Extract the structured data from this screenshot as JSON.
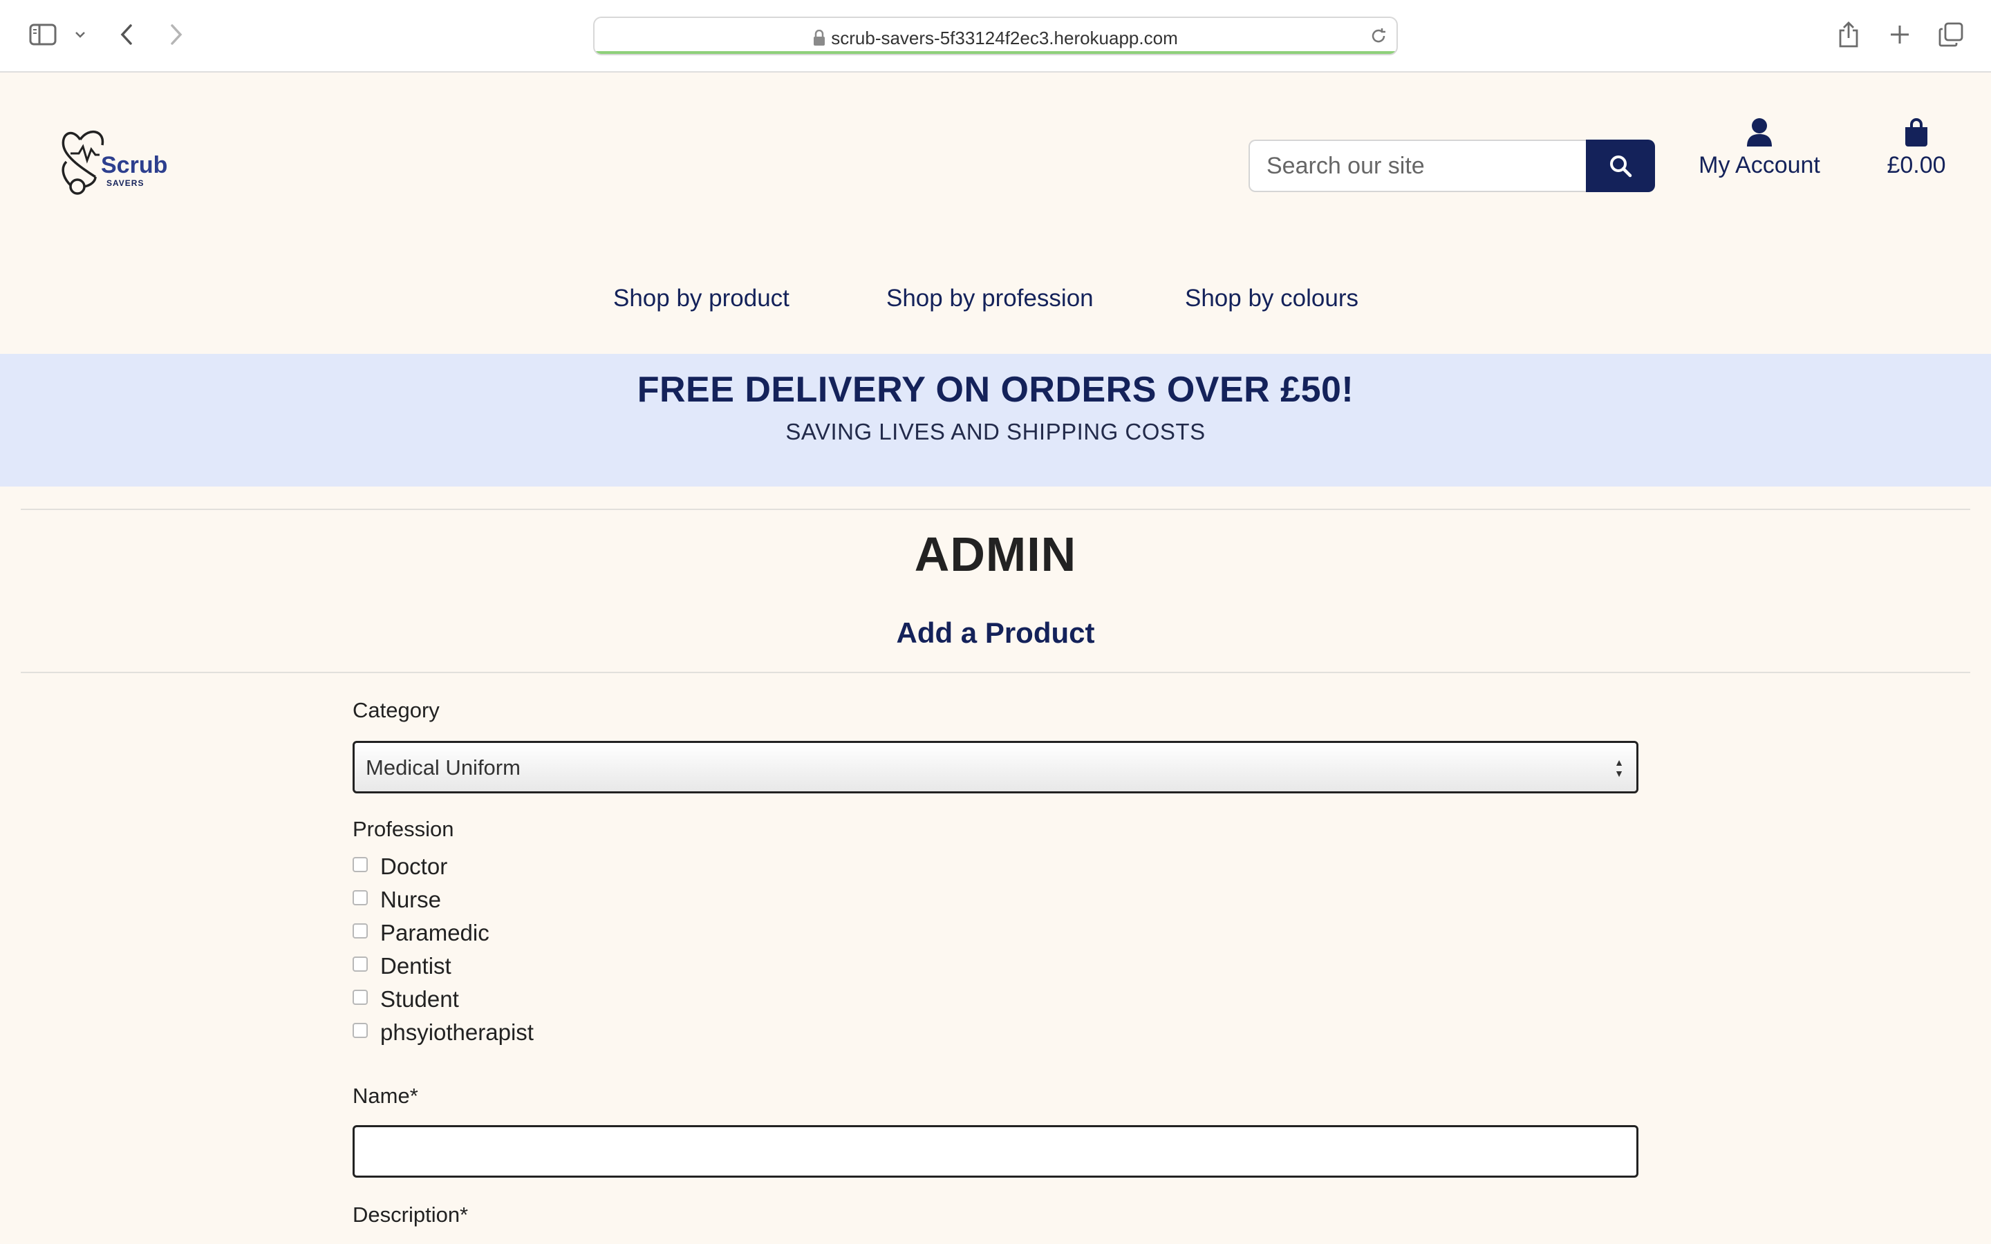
{
  "browser": {
    "url": "scrub-savers-5f33124f2ec3.herokuapp.com"
  },
  "brand": {
    "logo_main": "Scrub",
    "logo_sub": "SAVERS",
    "primary_color": "#14225a",
    "banner_color": "#e1e8fa",
    "page_bg": "#fdf8f1"
  },
  "header": {
    "search_placeholder": "Search our site",
    "account_label": "My Account",
    "cart_total": "£0.00"
  },
  "nav": {
    "items": [
      "Shop by product",
      "Shop by profession",
      "Shop by colours"
    ]
  },
  "banner": {
    "headline": "FREE DELIVERY ON ORDERS OVER £50!",
    "subline": "SAVING LIVES AND SHIPPING COSTS"
  },
  "page": {
    "title": "ADMIN",
    "subtitle": "Add a Product"
  },
  "form": {
    "category_label": "Category",
    "category_value": "Medical Uniform",
    "profession_label": "Profession",
    "professions": [
      "Doctor",
      "Nurse",
      "Paramedic",
      "Dentist",
      "Student",
      "phsyiotherapist"
    ],
    "name_label": "Name*",
    "name_value": "",
    "description_label": "Description*"
  }
}
